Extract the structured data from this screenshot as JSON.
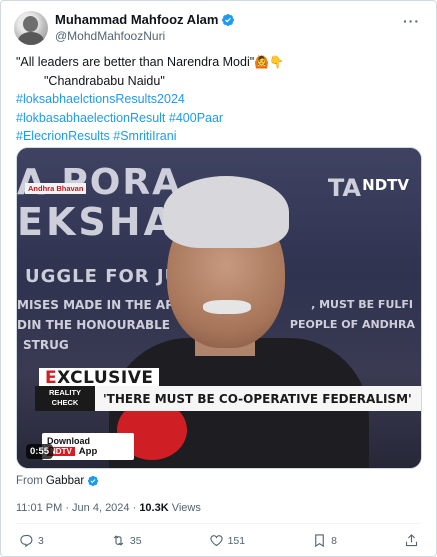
{
  "author": {
    "name": "Muhammad Mahfooz Alam",
    "handle": "@MohdMahfoozNuri"
  },
  "tweet": {
    "line1": "\"All leaders are better than Narendra Modi\"",
    "line2": "\"Chandrababu Naidu\"",
    "hashtags_line1": "#loksabhaelctionsResults2024",
    "hashtags_line2": "#lokbasabhaelectionResult #400Paar",
    "hashtags_line3": "#ElecrionResults #SmritiIrani",
    "emoji1": "🙆",
    "emoji2": "👇"
  },
  "media": {
    "banner_text_1": "A PORA",
    "banner_text_2": "EKSHA",
    "banner_text_3": "UGGLE FOR JUS",
    "banner_text_4": "MISES MADE IN THE AP",
    "banner_text_5": "DIN THE HONOURABLE",
    "banner_text_6": "STRUG",
    "banner_text_7": ", MUST BE FULFI",
    "banner_text_8": "PEOPLE OF ANDHRA",
    "banner_text_9": "TA",
    "location_tag": "Andhra Bhavan",
    "channel_logo": "NDTV",
    "exclusive_label": "XCLUSIVE",
    "exclusive_first": "E",
    "reality_check": "REALITY CHECK",
    "ticker": "'THERE MUST BE CO-OPERATIVE FEDERALISM'",
    "download_label": "Download",
    "download_brand": "NDTV",
    "download_app": "App",
    "duration": "0:55"
  },
  "source": {
    "prefix": "From",
    "name": "Gabbar"
  },
  "meta": {
    "time": "11:01 PM · Jun 4, 2024 · ",
    "views_count": "10.3K",
    "views_label": " Views"
  },
  "actions": {
    "replies": "3",
    "reposts": "35",
    "likes": "151",
    "bookmarks": "8"
  },
  "colors": {
    "link": "#1d9bf0",
    "verified": "#1d9bf0",
    "muted": "#536471"
  }
}
